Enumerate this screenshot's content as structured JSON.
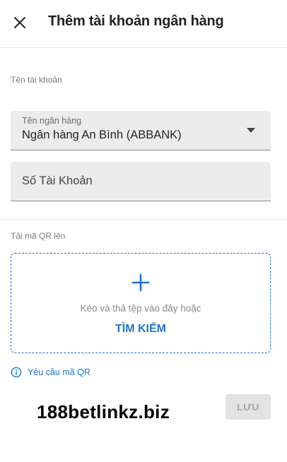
{
  "header": {
    "close_icon": "close-icon",
    "title": "Thêm tài khoản ngân hàng"
  },
  "account_section": {
    "label": "Tên tài khoản",
    "bank_field": {
      "floating_label": "Tên ngân hàng",
      "selected_value": "Ngân hàng An Bình (ABBANK)",
      "caret_icon": "caret-down-icon"
    },
    "account_number_field": {
      "placeholder": "Số Tài Khoản",
      "value": ""
    }
  },
  "qr_section": {
    "label": "Tải mã QR lên",
    "dropzone": {
      "icon": "plus-icon",
      "text": "Kéo và thả tệp vào đây hoặc",
      "link": "TÌM KIẾM"
    },
    "request_link": {
      "icon": "info-icon",
      "label": "Yêu cầu mã QR"
    }
  },
  "watermark": "188betlinkz.biz",
  "actions": {
    "save_label": "LƯU"
  },
  "colors": {
    "accent": "#1f74c7",
    "field_bg": "#ececec",
    "disabled_bg": "#e3e3e3"
  }
}
